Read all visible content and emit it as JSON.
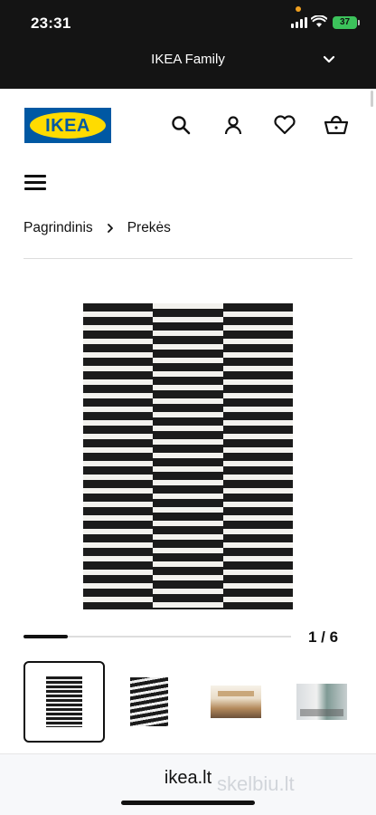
{
  "status_bar": {
    "time": "23:31",
    "battery": "37"
  },
  "family_bar": {
    "label": "IKEA Family"
  },
  "header": {
    "logo_text": "IKEA"
  },
  "breadcrumb": {
    "items": [
      "Pagrindinis",
      "Prekės"
    ]
  },
  "gallery": {
    "counter": "1 / 6",
    "current": 1,
    "total": 6
  },
  "browser": {
    "url": "ikea.lt",
    "watermark": "skelbiu.lt"
  },
  "colors": {
    "dark_bar": "#141414",
    "ikea_blue": "#0058a3",
    "ikea_yellow": "#ffdb00",
    "battery": "#3cc25b"
  },
  "icons": [
    "search-icon",
    "user-icon",
    "heart-icon",
    "cart-icon",
    "menu-icon",
    "chevron-down-icon",
    "chevron-right-icon"
  ]
}
